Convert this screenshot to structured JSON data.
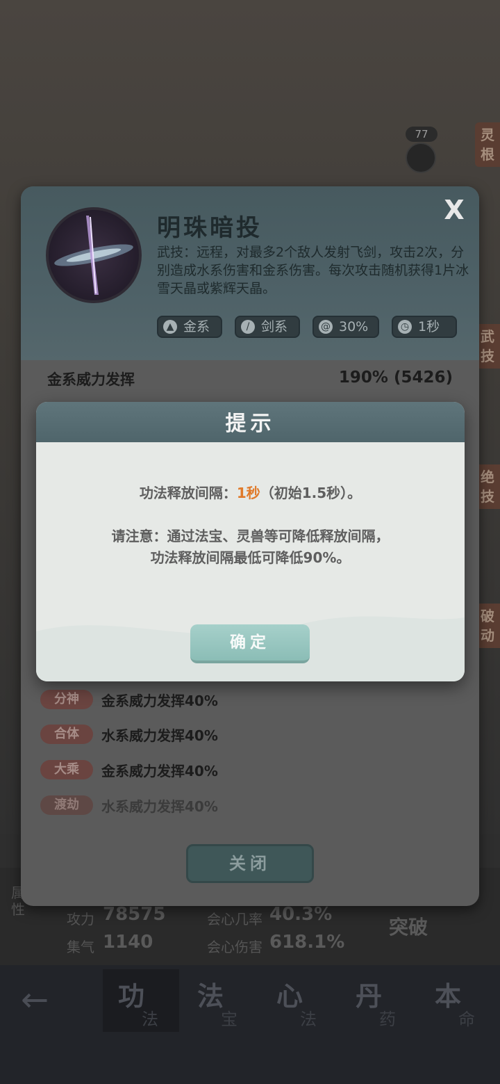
{
  "background": {
    "badge_value": "77",
    "side_tags": [
      "灵根",
      "武技",
      "绝技",
      "破动"
    ],
    "stats": [
      {
        "label": "攻力",
        "value": "78575"
      },
      {
        "label": "会心几率",
        "value": "40.3%"
      },
      {
        "label": "集气",
        "value": "1140"
      },
      {
        "label": "会心伤害",
        "value": "618.1%"
      }
    ],
    "stats_side_label": "属性",
    "break_label": "突破",
    "nav": {
      "back_icon": "arrow-left-icon",
      "tabs": [
        {
          "big": "功",
          "small": "法"
        },
        {
          "big": "法",
          "small": "宝"
        },
        {
          "big": "心",
          "small": "法"
        },
        {
          "big": "丹",
          "small": "药"
        },
        {
          "big": "本",
          "small": "命"
        }
      ]
    }
  },
  "skill_panel": {
    "name": "明珠暗投",
    "close_symbol": "X",
    "description": "武技：远程，对最多2个敌人发射飞剑，攻击2次，分别造成水系伤害和金系伤害。每次攻击随机获得1片冰雪天晶或紫辉天晶。",
    "tags": [
      {
        "icon": "gold-element-icon",
        "label": "金系"
      },
      {
        "icon": "sword-icon",
        "label": "剑系"
      },
      {
        "icon": "swirl-icon",
        "label": "30%"
      },
      {
        "icon": "clock-icon",
        "label": "1秒"
      }
    ],
    "power_label": "金系威力发挥",
    "power_value": "190% (5426)",
    "realms": [
      {
        "badge": "分神",
        "text": "金系威力发挥40%"
      },
      {
        "badge": "合体",
        "text": "水系威力发挥40%"
      },
      {
        "badge": "大乘",
        "text": "金系威力发挥40%"
      },
      {
        "badge": "渡劫",
        "text": "水系威力发挥40%"
      }
    ],
    "close_button": "关闭"
  },
  "dialog": {
    "title": "提示",
    "line1_prefix": "功法释放间隔：",
    "line1_highlight": "1秒",
    "line1_suffix": "（初始1.5秒）。",
    "line2": "请注意：通过法宝、灵兽等可降低释放间隔，",
    "line3": "功法释放间隔最低可降低90%。",
    "confirm_button": "确定"
  },
  "colors": {
    "panel_header": "#4e6167",
    "dialog_header": "#5f757b",
    "confirm_button": "#8bbdb6",
    "highlight": "#e07a2a",
    "realm_badge": "#6a4440"
  }
}
